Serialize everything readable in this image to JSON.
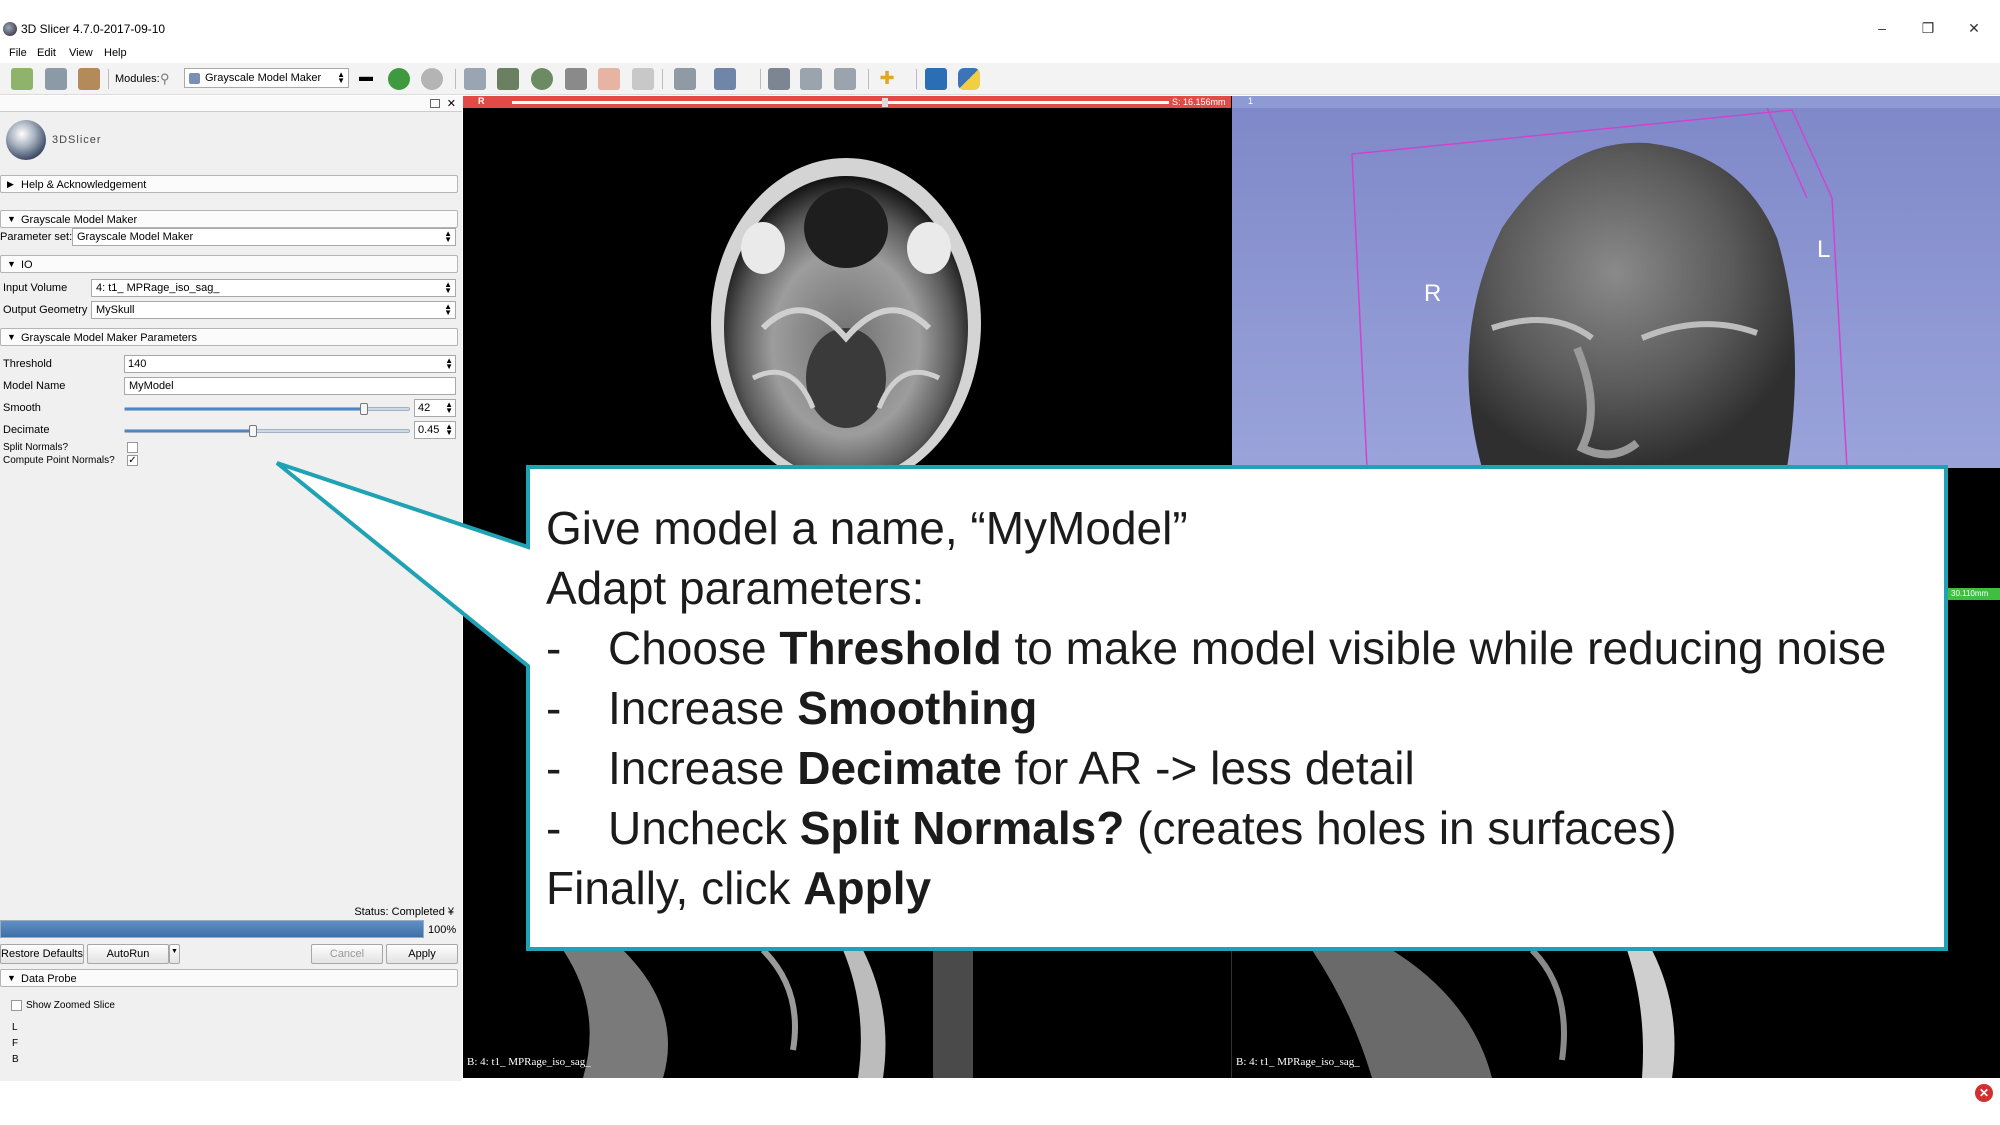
{
  "window": {
    "title": "3D Slicer 4.7.0-2017-09-10"
  },
  "menu": [
    "File",
    "Edit",
    "View",
    "Help"
  ],
  "toolbar": {
    "modules_label": "Modules:",
    "module_selected": "Grayscale Model Maker",
    "icons": [
      "data-icon",
      "dcm-icon",
      "save-icon",
      "layout-icon",
      "back-icon",
      "forward-icon"
    ]
  },
  "panel": {
    "logo_text": "3DSlicer",
    "help_section": "Help & Acknowledgement",
    "module_section": "Grayscale Model Maker",
    "parameter_set_label": "Parameter set:",
    "parameter_set_value": "Grayscale Model Maker",
    "io_section": "IO",
    "input_volume_label": "Input Volume",
    "input_volume_value": "4: t1_ MPRage_iso_sag_",
    "output_geometry_label": "Output Geometry",
    "output_geometry_value": "MySkull",
    "params_section": "Grayscale Model Maker Parameters",
    "threshold_label": "Threshold",
    "threshold_value": "140",
    "model_name_label": "Model Name",
    "model_name_value": "MyModel",
    "smooth_label": "Smooth",
    "smooth_value": "42",
    "smooth_fraction": 0.84,
    "decimate_label": "Decimate",
    "decimate_value": "0.45",
    "decimate_fraction": 0.45,
    "split_normals_label": "Split Normals?",
    "split_normals_checked": false,
    "compute_normals_label": "Compute Point Normals?",
    "compute_normals_checked": true,
    "compute_normals_mark": "✓",
    "status": "Status: Completed ¥",
    "progress_text": "100%",
    "progress_fraction": 1.0,
    "restore_defaults": "Restore Defaults",
    "autorun": "AutoRun",
    "cancel": "Cancel",
    "apply": "Apply",
    "data_probe_section": "Data Probe",
    "show_zoomed_slice": "Show Zoomed Slice",
    "probe_letters": [
      "L",
      "F",
      "B"
    ]
  },
  "views": {
    "red_letter": "R",
    "red_offset": "S: 16.156mm",
    "blue_index": "1",
    "label_3d_R": "R",
    "label_3d_L": "L",
    "green_offset": "30.110mm",
    "sag_left_label": "B: 4: t1_ MPRage_iso_sag_",
    "sag_right_label": "B: 4: t1_ MPRage_iso_sag_"
  },
  "callout": {
    "line1": "Give model a name, “MyModel”",
    "line2": "Adapt parameters:",
    "dash": "-",
    "b1_pre": "Choose ",
    "b1_bold": "Threshold",
    "b1_post": " to make model visible while reducing noise",
    "b2_pre": "Increase ",
    "b2_bold": "Smoothing",
    "b3_pre": "Increase ",
    "b3_bold": "Decimate",
    "b3_post": " for AR -> less detail",
    "b4_pre": "Uncheck ",
    "b4_bold": "Split Normals?",
    "b4_post": " (creates holes in surfaces)",
    "final_pre": "Finally, click ",
    "final_bold": "Apply"
  },
  "colors": {
    "callout_border": "#1fa2b4",
    "red_slice": "#e24b45",
    "view3d_bg": "#8e9ad4",
    "green_slice": "#3fbf3f",
    "progress": "#3e6fa8"
  }
}
